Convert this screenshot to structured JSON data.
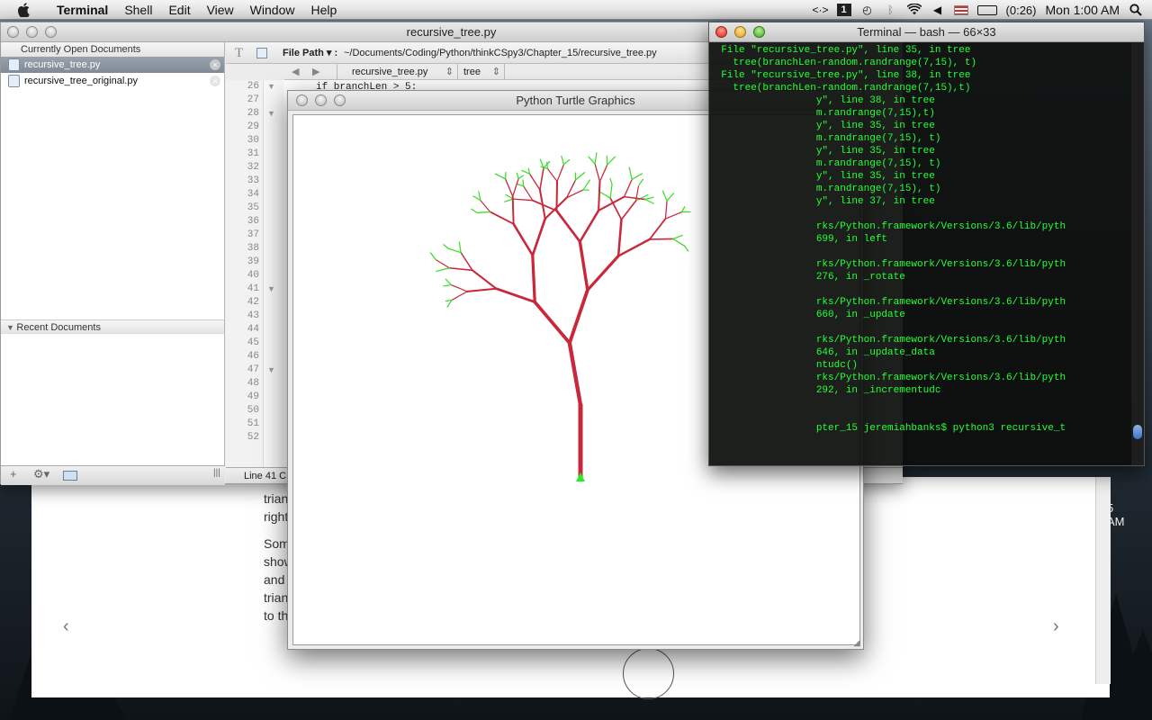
{
  "menubar": {
    "app_name": "Terminal",
    "items": [
      "Shell",
      "Edit",
      "View",
      "Window",
      "Help"
    ],
    "battery": "(0:26)",
    "clock": "Mon 1:00 AM"
  },
  "editor": {
    "window_title": "recursive_tree.py",
    "open_docs_header": "Currently Open Documents",
    "docs": [
      "recursive_tree.py",
      "recursive_tree_original.py"
    ],
    "recent_header": "Recent Documents",
    "file_path_label": "File Path ▾ :",
    "file_path": "~/Documents/Coding/Python/thinkCSpy3/Chapter_15/recursive_tree.py",
    "nav_file": "recursive_tree.py",
    "nav_symbol": "tree",
    "line_numbers": [
      "26",
      "27",
      "28",
      "29",
      "30",
      "31",
      "32",
      "33",
      "34",
      "35",
      "36",
      "37",
      "38",
      "39",
      "40",
      "41",
      "42",
      "43",
      "44",
      "45",
      "46",
      "47",
      "48",
      "49",
      "50",
      "51",
      "52"
    ],
    "code_first_line": "if branchLen > 5:",
    "status": "Line 41 C"
  },
  "turtle": {
    "window_title": "Python Turtle Graphics",
    "colors": {
      "branch": "#c8283a",
      "leaf": "#33dd22"
    }
  },
  "terminal": {
    "window_title": "Terminal — bash — 66×33",
    "lines": [
      "  File \"recursive_tree.py\", line 35, in tree",
      "    tree(branchLen-random.randrange(7,15), t)",
      "  File \"recursive_tree.py\", line 38, in tree",
      "    tree(branchLen-random.randrange(7,15),t)",
      "                  y\", line 38, in tree",
      "                  m.randrange(7,15),t)",
      "                  y\", line 35, in tree",
      "                  m.randrange(7,15), t)",
      "                  y\", line 35, in tree",
      "                  m.randrange(7,15), t)",
      "                  y\", line 35, in tree",
      "                  m.randrange(7,15), t)",
      "                  y\", line 37, in tree",
      "",
      "                  rks/Python.framework/Versions/3.6/lib/pyth",
      "                  699, in left",
      "",
      "                  rks/Python.framework/Versions/3.6/lib/pyth",
      "                  276, in _rotate",
      "",
      "                  rks/Python.framework/Versions/3.6/lib/pyth",
      "                  660, in _update",
      "",
      "                  rks/Python.framework/Versions/3.6/lib/pyth",
      "                  646, in _update_data",
      "                  ntudc()",
      "                  rks/Python.framework/Versions/3.6/lib/pyth",
      "                  292, in _incrementudc",
      "",
      "",
      "                  pter_15 jeremiahbanks$ python3 recursive_t"
    ]
  },
  "background_page": {
    "fragments": [
      "trian",
      "right",
      "Som",
      "show",
      "and",
      "trian",
      "to th"
    ],
    "clock_fragment": "5 AM"
  }
}
